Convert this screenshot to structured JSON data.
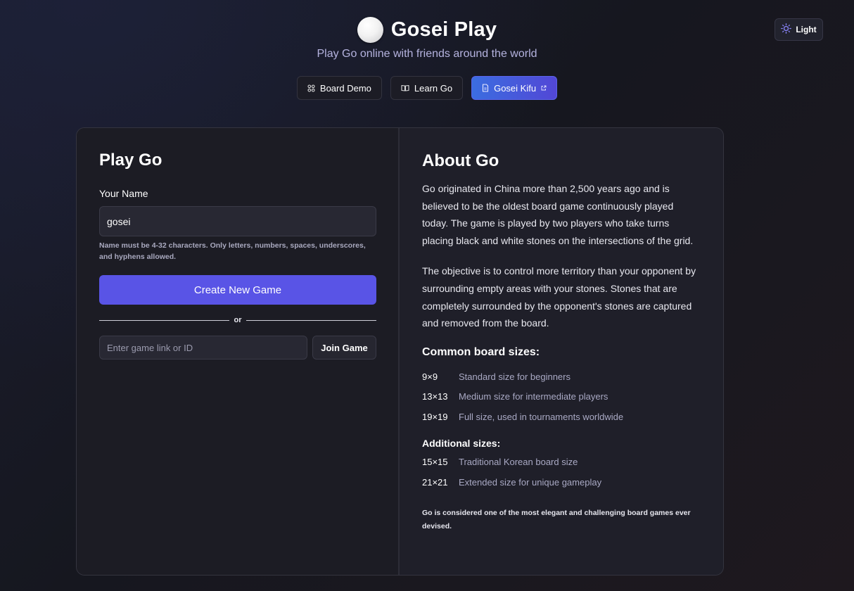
{
  "header": {
    "title": "Gosei Play",
    "tagline": "Play Go online with friends around the world",
    "nav": [
      {
        "label": "Board Demo",
        "icon": "grid-icon"
      },
      {
        "label": "Learn Go",
        "icon": "book-icon"
      },
      {
        "label": "Gosei Kifu",
        "icon": "document-icon",
        "external": true
      }
    ],
    "theme_toggle": {
      "label": "Light",
      "icon": "sun-icon"
    }
  },
  "play": {
    "heading": "Play Go",
    "name_label": "Your Name",
    "name_value": "gosei",
    "name_hint": "Name must be 4-32 characters. Only letters, numbers, spaces, underscores, and hyphens allowed.",
    "create_button": "Create New Game",
    "divider_text": "or",
    "join_placeholder": "Enter game link or ID",
    "join_button": "Join Game"
  },
  "about": {
    "heading": "About Go",
    "paragraphs": [
      "Go originated in China more than 2,500 years ago and is believed to be the oldest board game continuously played today. The game is played by two players who take turns placing black and white stones on the intersections of the grid.",
      "The objective is to control more territory than your opponent by surrounding empty areas with your stones. Stones that are completely surrounded by the opponent's stones are captured and removed from the board."
    ],
    "common_heading": "Common board sizes:",
    "common_sizes": [
      {
        "size": "9×9",
        "desc": "Standard size for beginners"
      },
      {
        "size": "13×13",
        "desc": "Medium size for intermediate players"
      },
      {
        "size": "19×19",
        "desc": "Full size, used in tournaments worldwide"
      }
    ],
    "additional_heading": "Additional sizes:",
    "additional_sizes": [
      {
        "size": "15×15",
        "desc": "Traditional Korean board size"
      },
      {
        "size": "21×21",
        "desc": "Extended size for unique gameplay"
      }
    ],
    "footnote": "Go is considered one of the most elegant and challenging board games ever devised."
  },
  "colors": {
    "accent": "#5954e6",
    "nav_primary_from": "#3b6de0",
    "nav_primary_to": "#5247d6",
    "background": "#17171f"
  }
}
